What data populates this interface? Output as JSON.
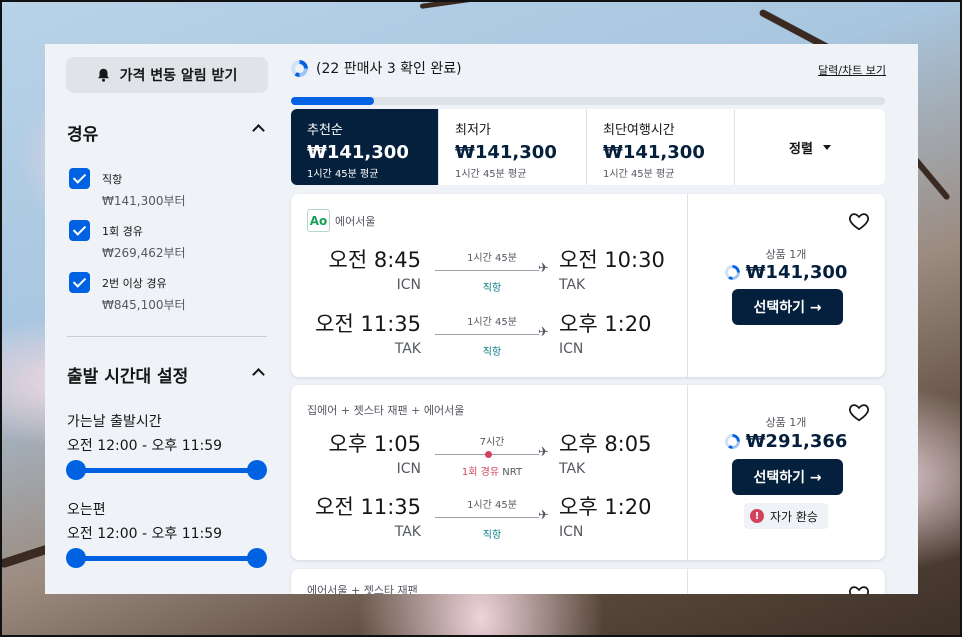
{
  "sidebar": {
    "price_alert_label": "가격 변동 알림 받기",
    "stops": {
      "heading": "경유",
      "options": [
        {
          "label": "직항",
          "price": "₩141,300부터",
          "checked": true
        },
        {
          "label": "1회 경유",
          "price": "₩269,462부터",
          "checked": true
        },
        {
          "label": "2번 이상 경유",
          "price": "₩845,100부터",
          "checked": true
        }
      ]
    },
    "departure_times": {
      "heading": "출발 시간대 설정",
      "outbound_label": "가는날 출발시간",
      "outbound_range": "오전 12:00 - 오후 11:59",
      "return_label": "오는편",
      "return_range": "오전 12:00 - 오후 11:59"
    }
  },
  "results": {
    "status_text": "(22 판매사 3 확인 완료)",
    "chart_link": "달력/차트 보기",
    "progress_fraction": 0.14,
    "sort_tabs": [
      {
        "name": "추천순",
        "price": "₩141,300",
        "avg": "1시간 45분 평균",
        "active": true
      },
      {
        "name": "최저가",
        "price": "₩141,300",
        "avg": "1시간 45분 평균",
        "active": false
      },
      {
        "name": "최단여행시간",
        "price": "₩141,300",
        "avg": "1시간 45분 평균",
        "active": false
      }
    ],
    "sort_dropdown_label": "정렬",
    "cards": [
      {
        "carrier": "에어서울",
        "logo_text": "Ao",
        "legs": [
          {
            "dep_time": "오전 8:45",
            "dep_airport": "ICN",
            "duration": "1시간 45분",
            "stop": "직항",
            "arr_time": "오전 10:30",
            "arr_airport": "TAK"
          },
          {
            "dep_time": "오전 11:35",
            "dep_airport": "TAK",
            "duration": "1시간 45분",
            "stop": "직항",
            "arr_time": "오후 1:20",
            "arr_airport": "ICN"
          }
        ],
        "deals_label": "상품 1개",
        "price": "₩141,300",
        "select_label": "선택하기 →"
      },
      {
        "carrier": "집에어 + 젯스타 재팬 + 에어서울",
        "legs": [
          {
            "dep_time": "오후 1:05",
            "dep_airport": "ICN",
            "duration": "7시간",
            "stop": "1회 경유",
            "stop_via": "NRT",
            "arr_time": "오후 8:05",
            "arr_airport": "TAK"
          },
          {
            "dep_time": "오전 11:35",
            "dep_airport": "TAK",
            "duration": "1시간 45분",
            "stop": "직항",
            "arr_time": "오후 1:20",
            "arr_airport": "ICN"
          }
        ],
        "deals_label": "상품 1개",
        "price": "₩291,366",
        "select_label": "선택하기 →",
        "badge": "자가 환승"
      },
      {
        "carrier": "에어서울 + 젯스타 재팬"
      }
    ]
  }
}
